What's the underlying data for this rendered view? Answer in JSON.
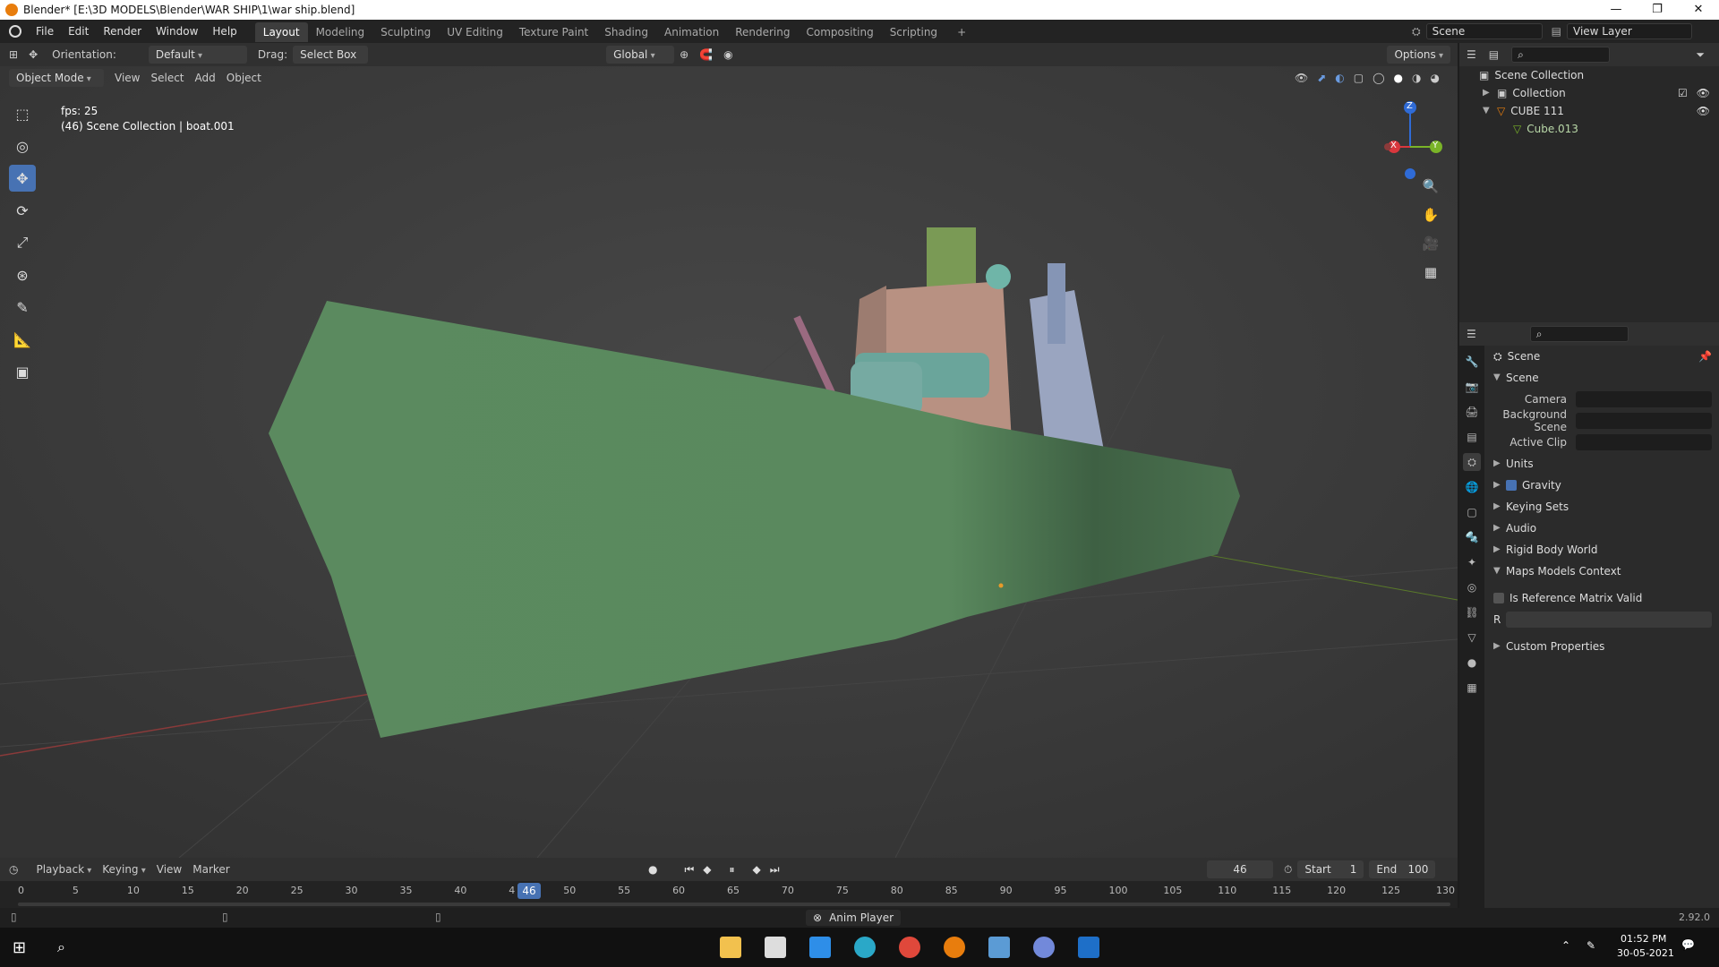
{
  "window": {
    "title": "Blender* [E:\\3D MODELS\\Blender\\WAR SHIP\\1\\war ship.blend]"
  },
  "menu": [
    "File",
    "Edit",
    "Render",
    "Window",
    "Help"
  ],
  "workspaces": [
    "Layout",
    "Modeling",
    "Sculpting",
    "UV Editing",
    "Texture Paint",
    "Shading",
    "Animation",
    "Rendering",
    "Compositing",
    "Scripting"
  ],
  "topright": {
    "scene": "Scene",
    "view_layer": "View Layer"
  },
  "vpheader": {
    "orientation_label": "Orientation:",
    "orientation_value": "Default",
    "drag_label": "Drag:",
    "drag_value": "Select Box",
    "transform": "Global",
    "options": "Options"
  },
  "vpheader2": {
    "mode": "Object Mode",
    "view": "View",
    "select": "Select",
    "add": "Add",
    "object": "Object"
  },
  "overlay": {
    "fps": "fps: 25",
    "context": "(46) Scene Collection | boat.001"
  },
  "gizmo": {
    "x": "X",
    "y": "Y",
    "z": "Z"
  },
  "outliner": {
    "rows": [
      {
        "label": "Scene Collection"
      },
      {
        "label": "Collection"
      },
      {
        "label": "CUBE 111"
      },
      {
        "label": "Cube.013"
      }
    ]
  },
  "props": {
    "context": "Scene",
    "panel": "Scene",
    "camera_label": "Camera",
    "bg_scene_label": "Background Scene",
    "active_clip_label": "Active Clip",
    "sections": [
      "Units",
      "Gravity",
      "Keying Sets",
      "Audio",
      "Rigid Body World",
      "Maps Models Context"
    ],
    "ref_matrix": "Is Reference Matrix Valid",
    "r_label": "R",
    "custom": "Custom Properties"
  },
  "timeline": {
    "playback": "Playback",
    "keying": "Keying",
    "view": "View",
    "marker": "Marker",
    "current": "46",
    "start_label": "Start",
    "start": "1",
    "end_label": "End",
    "end": "100",
    "ticks": [
      "0",
      "5",
      "10",
      "15",
      "20",
      "25",
      "30",
      "35",
      "40",
      "4",
      "50",
      "55",
      "60",
      "65",
      "70",
      "75",
      "80",
      "85",
      "90",
      "95",
      "100",
      "105",
      "110",
      "115",
      "120",
      "125",
      "130"
    ]
  },
  "status": {
    "center": "Anim Player",
    "version": "2.92.0"
  },
  "taskbar": {
    "time": "01:52 PM",
    "date": "30-05-2021"
  },
  "colors": {
    "accent": "#4772b3",
    "hull": "#5a8a5e",
    "outline_orange": "#e87d0d"
  }
}
